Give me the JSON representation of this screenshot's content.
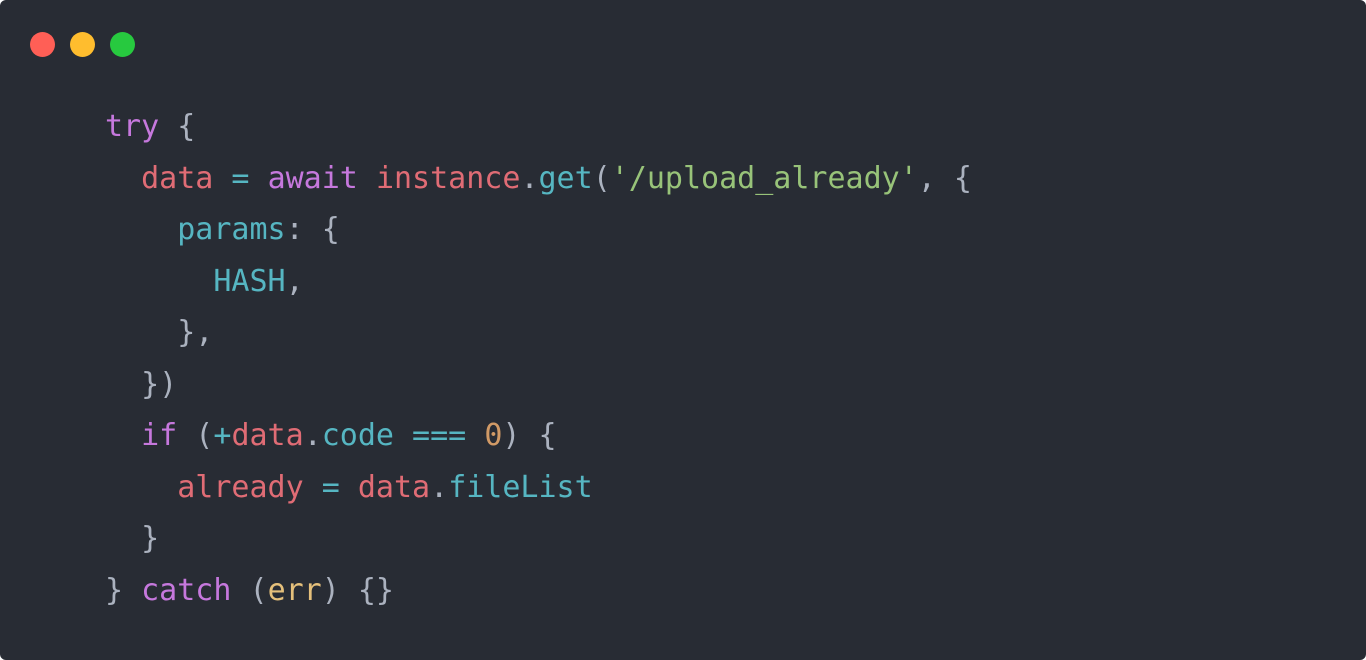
{
  "window": {
    "controls": [
      {
        "name": "close",
        "color": "#ff5f56"
      },
      {
        "name": "minimize",
        "color": "#ffbd2e"
      },
      {
        "name": "maximize",
        "color": "#27c93f"
      }
    ]
  },
  "theme": {
    "background": "#282c34",
    "default": "#abb2bf",
    "keyword": "#c678dd",
    "variable": "#e06c75",
    "property": "#56b6c2",
    "function": "#56b6c2",
    "string": "#98c379",
    "number": "#d19a66",
    "param": "#e5c07b"
  },
  "code": {
    "lines": [
      {
        "indent": "",
        "tokens": [
          {
            "text": "try",
            "kind": "keyword"
          },
          {
            "text": " {",
            "kind": "default"
          }
        ]
      },
      {
        "indent": "  ",
        "tokens": [
          {
            "text": "data",
            "kind": "variable"
          },
          {
            "text": " = ",
            "kind": "property"
          },
          {
            "text": "await",
            "kind": "keyword"
          },
          {
            "text": " ",
            "kind": "default"
          },
          {
            "text": "instance",
            "kind": "variable"
          },
          {
            "text": ".",
            "kind": "default"
          },
          {
            "text": "get",
            "kind": "function"
          },
          {
            "text": "(",
            "kind": "default"
          },
          {
            "text": "'/upload_already'",
            "kind": "string"
          },
          {
            "text": ", {",
            "kind": "default"
          }
        ]
      },
      {
        "indent": "    ",
        "tokens": [
          {
            "text": "params",
            "kind": "property"
          },
          {
            "text": ": {",
            "kind": "default"
          }
        ]
      },
      {
        "indent": "      ",
        "tokens": [
          {
            "text": "HASH",
            "kind": "property"
          },
          {
            "text": ",",
            "kind": "default"
          }
        ]
      },
      {
        "indent": "    ",
        "tokens": [
          {
            "text": "},",
            "kind": "default"
          }
        ]
      },
      {
        "indent": "  ",
        "tokens": [
          {
            "text": "})",
            "kind": "default"
          }
        ]
      },
      {
        "indent": "  ",
        "tokens": [
          {
            "text": "if",
            "kind": "keyword"
          },
          {
            "text": " (",
            "kind": "default"
          },
          {
            "text": "+",
            "kind": "property"
          },
          {
            "text": "data",
            "kind": "variable"
          },
          {
            "text": ".",
            "kind": "default"
          },
          {
            "text": "code",
            "kind": "property"
          },
          {
            "text": " === ",
            "kind": "property"
          },
          {
            "text": "0",
            "kind": "number"
          },
          {
            "text": ") {",
            "kind": "default"
          }
        ]
      },
      {
        "indent": "    ",
        "tokens": [
          {
            "text": "already",
            "kind": "variable"
          },
          {
            "text": " = ",
            "kind": "property"
          },
          {
            "text": "data",
            "kind": "variable"
          },
          {
            "text": ".",
            "kind": "default"
          },
          {
            "text": "fileList",
            "kind": "property"
          }
        ]
      },
      {
        "indent": "  ",
        "tokens": [
          {
            "text": "}",
            "kind": "default"
          }
        ]
      },
      {
        "indent": "",
        "tokens": [
          {
            "text": "} ",
            "kind": "default"
          },
          {
            "text": "catch",
            "kind": "keyword"
          },
          {
            "text": " (",
            "kind": "default"
          },
          {
            "text": "err",
            "kind": "param"
          },
          {
            "text": ") {}",
            "kind": "default"
          }
        ]
      }
    ]
  }
}
